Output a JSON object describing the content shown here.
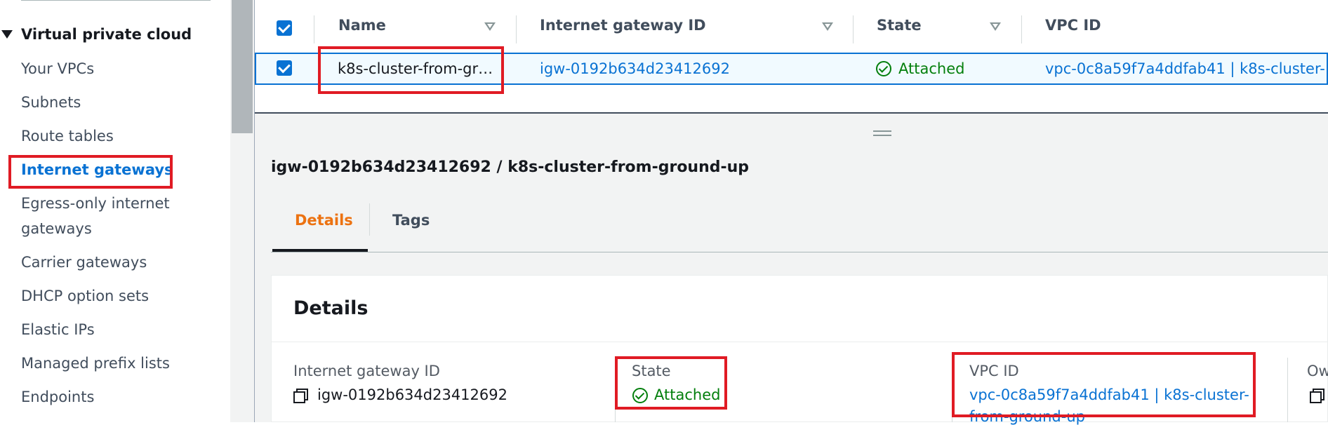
{
  "sidebar": {
    "section_title": "Virtual private cloud",
    "items": [
      {
        "label": "Your VPCs"
      },
      {
        "label": "Subnets"
      },
      {
        "label": "Route tables"
      },
      {
        "label": "Internet gateways"
      },
      {
        "label": "Egress-only internet"
      },
      {
        "label": "gateways"
      },
      {
        "label": "Carrier gateways"
      },
      {
        "label": "DHCP option sets"
      },
      {
        "label": "Elastic IPs"
      },
      {
        "label": "Managed prefix lists"
      },
      {
        "label": "Endpoints"
      }
    ]
  },
  "table": {
    "headers": [
      "Name",
      "Internet gateway ID",
      "State",
      "VPC ID"
    ],
    "row": {
      "name": "k8s-cluster-from-gr…",
      "gateway_id": "igw-0192b634d23412692",
      "state": "Attached",
      "vpc_id": "vpc-0c8a59f7a4ddfab41 | k8s-cluster-…"
    }
  },
  "detail": {
    "title": "igw-0192b634d23412692 / k8s-cluster-from-ground-up",
    "tabs": [
      "Details",
      "Tags"
    ],
    "panel_title": "Details",
    "fields": {
      "gateway_id_label": "Internet gateway ID",
      "gateway_id_value": "igw-0192b634d23412692",
      "state_label": "State",
      "state_value": "Attached",
      "vpc_label": "VPC ID",
      "vpc_value_line1": "vpc-0c8a59f7a4ddfab41 | k8s-cluster-",
      "vpc_value_line2": "from-ground-up",
      "owner_label": "Ow"
    }
  },
  "colors": {
    "link": "#0972d3",
    "success": "#037f0c",
    "active_tab": "#ec7211",
    "highlight": "#e01b24"
  }
}
